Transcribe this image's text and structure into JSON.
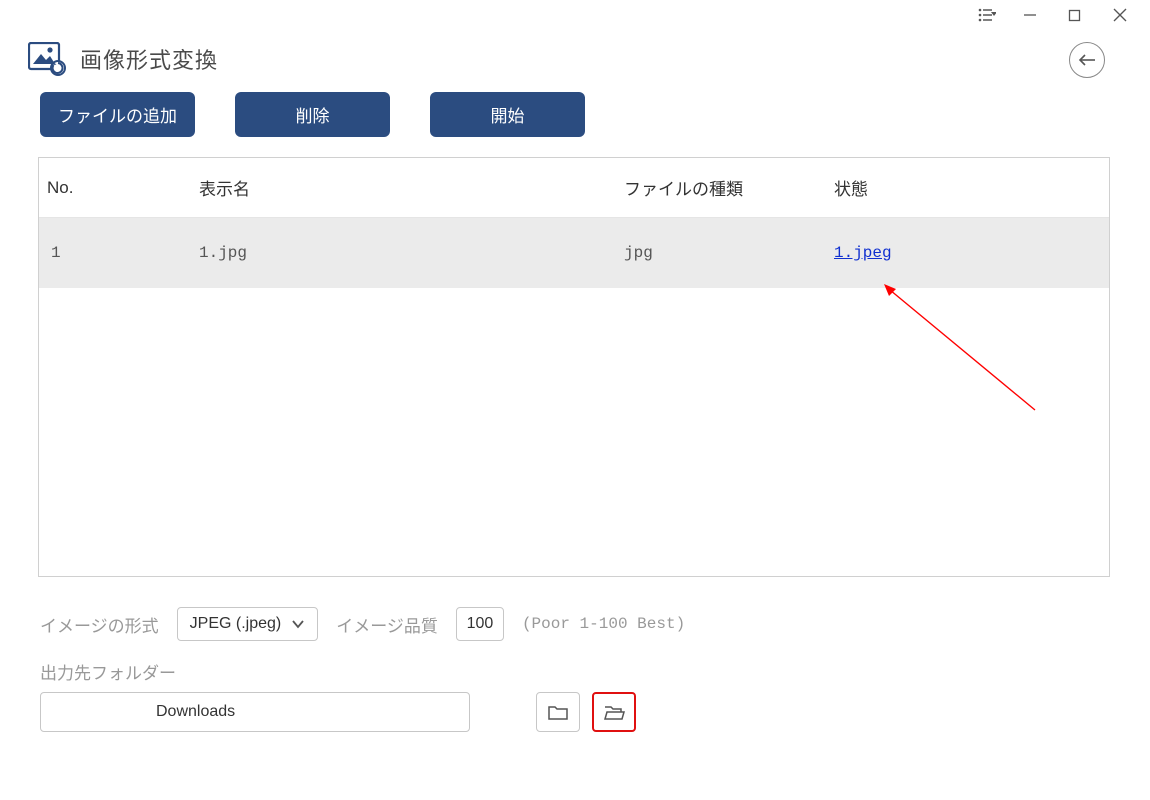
{
  "app": {
    "title": "画像形式変換"
  },
  "toolbar": {
    "add_file": "ファイルの追加",
    "delete": "削除",
    "start": "開始"
  },
  "table": {
    "headers": {
      "no": "No.",
      "name": "表示名",
      "type": "ファイルの種類",
      "status": "状態"
    },
    "rows": [
      {
        "no": "1",
        "name": "1.jpg",
        "type": "jpg",
        "status": "1.jpeg"
      }
    ]
  },
  "options": {
    "format_label": "イメージの形式",
    "format_value": "JPEG (.jpeg)",
    "quality_label": "イメージ品質",
    "quality_value": "100",
    "quality_range": "(Poor 1-100 Best)"
  },
  "output": {
    "label": "出力先フォルダー",
    "path": "Downloads"
  }
}
